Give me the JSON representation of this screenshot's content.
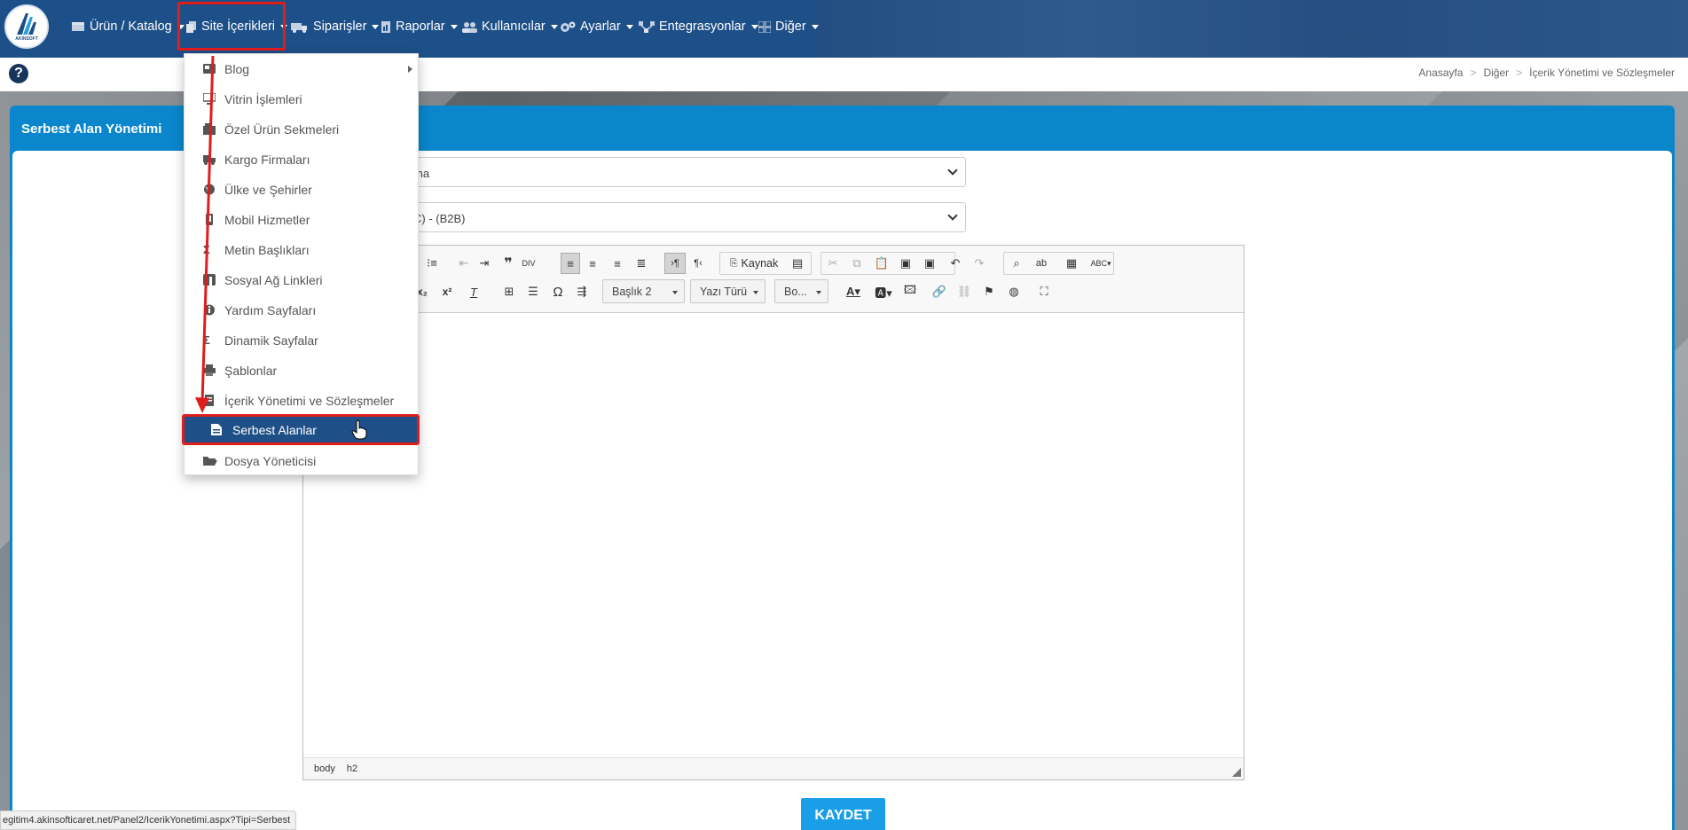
{
  "nav": {
    "logo_text": "AKINSOFT",
    "items": [
      {
        "label": "Ürün / Katalog",
        "icon": "box-icon"
      },
      {
        "label": "Site İçerikleri",
        "icon": "files-icon"
      },
      {
        "label": "Siparişler",
        "icon": "truck-icon"
      },
      {
        "label": "Raporlar",
        "icon": "report-icon"
      },
      {
        "label": "Kullanıcılar",
        "icon": "users-icon"
      },
      {
        "label": "Ayarlar",
        "icon": "gears-icon"
      },
      {
        "label": "Entegrasyonlar",
        "icon": "network-icon"
      },
      {
        "label": "Diğer",
        "icon": "grid-icon"
      }
    ]
  },
  "breadcrumb": [
    "Anasayfa",
    "Diğer",
    "İçerik Yönetimi ve Sözleşmeler"
  ],
  "breadcrumb_sep": ">",
  "help_glyph": "?",
  "panel_title": "Serbest Alan Yönetimi",
  "form": {
    "select1_value": "ma",
    "select2_value": "C) - (B2B)"
  },
  "editor": {
    "source_label": "Kaynak",
    "heading_combo": "Başlık 2",
    "font_combo": "Yazı Türü",
    "size_combo": "Bo...",
    "path": [
      "body",
      "h2"
    ]
  },
  "save_label": "KAYDET",
  "status_url": "egitim4.akinsofticaret.net/Panel2/IcerikYonetimi.aspx?Tipi=Serbest",
  "dropdown": {
    "items": [
      "Blog",
      "Vitrin İşlemleri",
      "Özel Ürün Sekmeleri",
      "Kargo Firmaları",
      "Ülke ve Şehirler",
      "Mobil Hizmetler",
      "Metin Başlıkları",
      "Sosyal Ağ Linkleri",
      "Yardım Sayfaları",
      "Dinamik Sayfalar",
      "Şablonlar",
      "İçerik Yönetimi ve Sözleşmeler"
    ],
    "active": "Serbest Alanlar",
    "last": "Dosya Yöneticisi"
  },
  "colors": {
    "nav_bg": "#1d4f88",
    "panel_blue": "#0a86cc",
    "save_blue": "#1a9ee8",
    "highlight_red": "#e01d1d"
  }
}
